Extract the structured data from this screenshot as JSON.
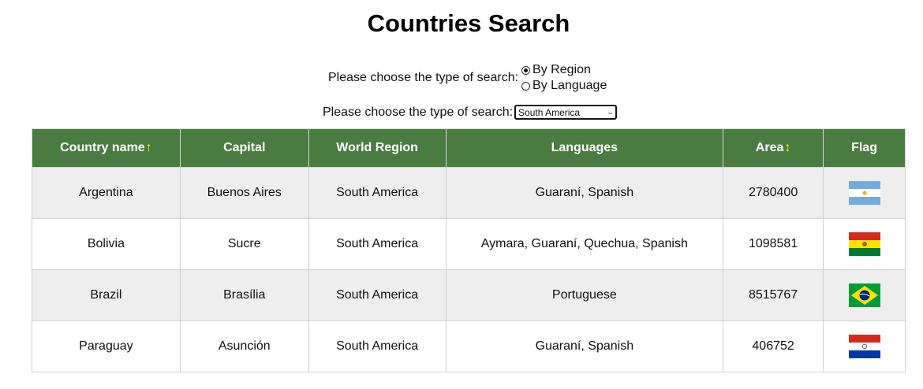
{
  "title": "Countries Search",
  "search_type": {
    "label": "Please choose the type of search:",
    "options": [
      {
        "label": "By Region",
        "checked": true
      },
      {
        "label": "By Language",
        "checked": false
      }
    ]
  },
  "region_select": {
    "label": "Please choose the type of search:",
    "selected": "South America"
  },
  "table": {
    "headers": {
      "country": "Country name",
      "country_sort": "↑",
      "capital": "Capital",
      "region": "World Region",
      "languages": "Languages",
      "area": "Area",
      "area_sort": "↕",
      "flag": "Flag"
    },
    "rows": [
      {
        "name": "Argentina",
        "capital": "Buenos Aires",
        "region": "South America",
        "languages": "Guaraní, Spanish",
        "area": "2780400",
        "flag_icon": "argentina-flag-icon"
      },
      {
        "name": "Bolivia",
        "capital": "Sucre",
        "region": "South America",
        "languages": "Aymara, Guaraní, Quechua, Spanish",
        "area": "1098581",
        "flag_icon": "bolivia-flag-icon"
      },
      {
        "name": "Brazil",
        "capital": "Brasília",
        "region": "South America",
        "languages": "Portuguese",
        "area": "8515767",
        "flag_icon": "brazil-flag-icon"
      },
      {
        "name": "Paraguay",
        "capital": "Asunción",
        "region": "South America",
        "languages": "Guaraní, Spanish",
        "area": "406752",
        "flag_icon": "paraguay-flag-icon"
      }
    ]
  },
  "colors": {
    "header_bg": "#4a7c42",
    "sort_arrow": "#f5f500",
    "row_alt": "#eeeeee"
  }
}
